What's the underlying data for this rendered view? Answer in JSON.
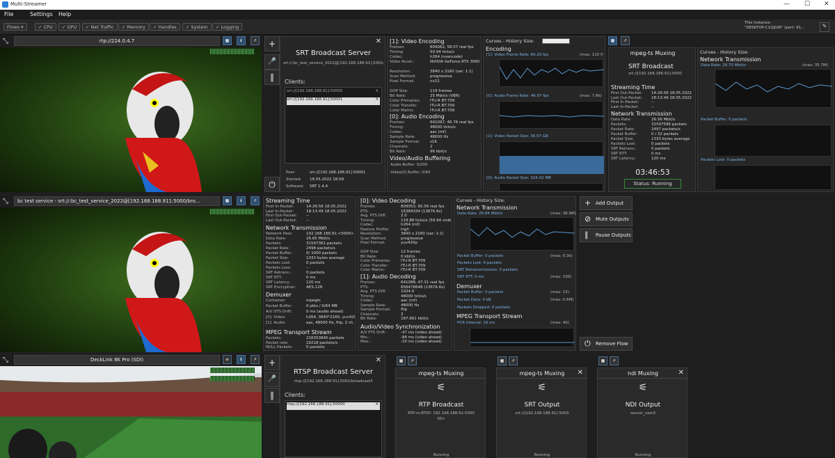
{
  "window": {
    "title": "Multi-Streamer"
  },
  "menu": [
    "File",
    "Settings",
    "Help"
  ],
  "toolbar": {
    "flows": "Flows ▾",
    "toggles": [
      "CPU",
      "GPU",
      "Net Traffic",
      "Memory",
      "Handles",
      "System",
      "Logging"
    ],
    "instance_label": "This Instance:",
    "instance_value": "\"DESKTOP-C1QJGIR\" (port: 91..."
  },
  "flows": [
    {
      "title": "rtp://224.0.4.7"
    },
    {
      "title": "bc test service - srt://:bc_test_service_2022@[192.168.188.911:5000/bro..."
    },
    {
      "title": "DeckLink 8K Pro (SDI)"
    }
  ],
  "srt_server": {
    "title": "SRT Broadcast Server",
    "url": "srt://:bc_test_service_2022@[192.168.188.91]:5000/broadcast3",
    "clients_label": "Clients:",
    "clients": [
      "srt://[192.168.188.91]:50000",
      "srt://[192.168.188.91]:50001"
    ],
    "peer_label": "Peer:",
    "peer": "srt://[192.168.188.91]:50001",
    "started_label": "Started:",
    "started": "18.05.2022 18:09",
    "software_label": "Software:",
    "software": "SRT 1.4.4"
  },
  "video_encoding": {
    "title": "[1]: Video Encoding",
    "rows": [
      [
        "Frames:",
        "809062, 58.07 real fps"
      ],
      [
        "Timing:",
        "59.94 ticks/s"
      ],
      [
        "Codec:",
        "h264 (nvencode)"
      ],
      [
        "Video Accel.:",
        "NVIDIA GeForce RTX 3060"
      ],
      [
        "",
        "[DirectX API]"
      ],
      [
        "Resolution:",
        "3840 x 2160 (sar: 1:1)"
      ],
      [
        "Scan Method:",
        "progressive"
      ],
      [
        "Pixel Format:",
        "nv12"
      ],
      [
        "",
        "(YUV 4:2:0, 8 bit)"
      ],
      [
        "GOP Size:",
        "119 frames"
      ],
      [
        "Bit Rate:",
        "25 Mbit/s (VBR)"
      ],
      [
        "Color Primaries:",
        "ITU-R BT.709"
      ],
      [
        "Color Transfer:",
        "ITU-R BT.709"
      ],
      [
        "Color Matrix:",
        "ITU-R BT.709"
      ]
    ]
  },
  "audio_encoding": {
    "title": "[0]: Audio Encoding",
    "rows": [
      [
        "Frames:",
        "641097, 46.76 real fps"
      ],
      [
        "Timing:",
        "48000 ticks/s"
      ],
      [
        "Codec:",
        "aac (mf)"
      ],
      [
        "Sample Rate:",
        "48000 Hz"
      ],
      [
        "Sample Format:",
        "s16"
      ],
      [
        "Channels:",
        "2"
      ],
      [
        "Bit Rate:",
        "96 kbit/s"
      ]
    ]
  },
  "av_buffering": {
    "title": "Video/Audio Buffering",
    "audio_buffer": "Audio Buffer: 0/200",
    "video_buffer": "Video[0] Buffer: 0/60"
  },
  "curves1": {
    "title": "Curves - History Size:",
    "section": "Encoding",
    "series": [
      "[1]: Video Frame Rate: 60.20 fps",
      "[0]: Audio Frame Rate: 46.07 fps",
      "[1]: Video Packet Size: 36.57 GB",
      "[0]: Audio Packet Size: 324.02 MB"
    ],
    "max": [
      "(max: 110 f)",
      "(max: 7.8k)"
    ],
    "ticks": [
      "30s",
      "24s",
      "18s",
      "12s",
      "6s",
      "1"
    ]
  },
  "mpegts1": {
    "title": "mpeg-ts Muxing",
    "out": "SRT Broadcast",
    "out_url": "srt://[192.168.188.91]:5000",
    "streaming_time": "Streaming Time",
    "st_rows": [
      [
        "First Out-Packet:",
        "14:26:56 18.05.2022"
      ],
      [
        "Last Out-Packet:",
        "18:13:49 18.05.2022"
      ],
      [
        "First In-Packet:",
        "--"
      ],
      [
        "Last In-Packet:",
        "--"
      ]
    ],
    "net": "Network Transmission",
    "net_rows": [
      [
        "Data Rate:",
        "26.56 Mbit/s"
      ],
      [
        "Packets:",
        "31597596 packets"
      ],
      [
        "Packet Rate:",
        "2497 packets/s"
      ],
      [
        "Packet Buffer:",
        "0 / 32 packets"
      ],
      [
        "Packet Size:",
        "1333 bytes average"
      ],
      [
        "Packets Lost:",
        "0 packets"
      ],
      [
        "SRT Retrans.:",
        "0 packets"
      ],
      [
        "SRT RTT:",
        "0 ms"
      ],
      [
        "SRT Latency:",
        "120 ms"
      ]
    ],
    "timer": "03:46:53",
    "status": "Status: Running",
    "curves": "Curves - History Size:",
    "curve_section": "Network Transmission",
    "curve_rate": "Data Rate: 26.70 Mbit/s",
    "curve_max": "(max: 35.7M)",
    "pkt_buffer": "Packet Buffer: 0 packets",
    "pkt_lost": "Packets Lost: 0 packets"
  },
  "streaming2": {
    "title": "Streaming Time",
    "rows": [
      [
        "First In-Packet:",
        "14:26:56 18.05.2022"
      ],
      [
        "Last In-Packet:",
        "18:13:49 18.05.2022"
      ],
      [
        "First Out-Packet:",
        "--"
      ],
      [
        "Last Out-Packet:",
        "--"
      ]
    ],
    "net": "Network Transmission",
    "net_rows": [
      [
        "Network Peer:",
        "192.168.188.91:<5000>"
      ],
      [
        "Data Rate:",
        "26.65 Mbit/s"
      ],
      [
        "Packets:",
        "31597361 packets"
      ],
      [
        "Packet Rate:",
        "2498 packets/s"
      ],
      [
        "Packet Buffer:",
        "0/ 1000 packets"
      ],
      [
        "Packet Size:",
        "1333 bytes average"
      ],
      [
        "Packets Lost:",
        "0 packets"
      ],
      [
        "Packets Loss:",
        "--"
      ],
      [
        "SRT Retrans.:",
        "0 packets"
      ],
      [
        "SRT RTT:",
        "0 ms"
      ],
      [
        "SRT Latency:",
        "120 ms"
      ],
      [
        "SRT Encryption:",
        "AES-128"
      ]
    ],
    "demux": "Demuxer",
    "demux_rows": [
      [
        "Container:",
        "mpegts"
      ],
      [
        "Packet Buffer:",
        "0 pkts / 0/64 MB"
      ],
      [
        "A/V DTS Drift:",
        "0 ms (audio ahead)"
      ],
      [
        "[0]: Video:",
        "h264, 3840*2160, yuv420p"
      ],
      [
        "[1]: Audio:",
        "aac, 48000 Hz, fltp, 2 ch."
      ]
    ],
    "mpeg": "MPEG Transport Stream",
    "mpeg_rows": [
      [
        "Packets:",
        "216353840 packets"
      ],
      [
        "Packet rate:",
        "19218 packets/s"
      ],
      [
        "NULL Packets:",
        "0 packets"
      ]
    ]
  },
  "video_decoding": {
    "title": "[0]: Video Decoding",
    "rows": [
      [
        "Frames:",
        "809053, 60.56 real fps"
      ],
      [
        "PTS:",
        "16384334 (13676.6s)"
      ],
      [
        "Avg. PTS Diff:",
        "2.0"
      ],
      [
        "Timing:",
        "119.88 ticks/s (59.94 visible fr"
      ],
      [
        "Codec:",
        "h264 (mf)"
      ],
      [
        "Feature Profile:",
        "high"
      ],
      [
        "Resolution:",
        "3840 x 2160 (sar: 1:1)"
      ],
      [
        "Scan Method:",
        "progressive"
      ],
      [
        "Pixel Format:",
        "yuv420p"
      ],
      [
        "",
        "(YUV 4:2:0, 8 bit)"
      ],
      [
        "GOP Size:",
        "12 frames"
      ],
      [
        "Bit Rate:",
        "0 kbit/s"
      ],
      [
        "Color Primaries:",
        "ITU-R BT.709"
      ],
      [
        "Color Transfer:",
        "ITU-R BT.709"
      ],
      [
        "Color Matrix:",
        "ITU-R BT.709"
      ]
    ]
  },
  "audio_decoding": {
    "title": "[1]: Audio Decoding",
    "rows": [
      [
        "Frames:",
        "641088, 47.31 real fps"
      ],
      [
        "PTS:",
        "656478648 (13676.6s)"
      ],
      [
        "Avg. PTS Diff:",
        "1024.0"
      ],
      [
        "Timing:",
        "48000 ticks/s"
      ],
      [
        "Codec:",
        "aac (mf)"
      ],
      [
        "Sample Rate:",
        "48000 Hz"
      ],
      [
        "Sample Format:",
        "fltp"
      ],
      [
        "Channels:",
        "2"
      ],
      [
        "Bit Rate:",
        "187.961 kbit/s"
      ]
    ]
  },
  "av_sync": {
    "title": "Audio/Video Synchronization",
    "rows": [
      [
        "A/V PTS Drift:",
        "-47 ms (video ahead)"
      ],
      [
        "Min.:",
        "-84 ms (video ahead)"
      ],
      [
        "Max.:",
        "-20 ms (video ahead)"
      ]
    ]
  },
  "curves2": {
    "title": "Curves - History Size:",
    "net": "Network Transmission",
    "net_rate": "Data Rate: 26.84 Mbit/s",
    "net_max": "(max: 36.9M)",
    "lines": [
      "Packet Buffer: 0 packets",
      "Packets Lost: 0 packets",
      "SRT Retransmissions: 0 packets",
      "SRT RTT: 0 ms"
    ],
    "line_max": [
      "(max: 0.3k)",
      "(max: 100)"
    ],
    "demux": "Demuxer",
    "demux_lines": [
      "Packet Buffer: 0 packets",
      "Packet Data: 0 kB",
      "Packets Dropped: 0 packets"
    ],
    "demux_max": [
      "(max: 15)",
      "(max: 0.6M)"
    ],
    "mpeg": "MPEG Transport Stream",
    "pcr": "PCR Interval: 16 ms",
    "pcr_max": "(max: 40)",
    "ticks": [
      "30s",
      "24s",
      "18s",
      "12s",
      "6s",
      "1s"
    ]
  },
  "actions": {
    "add": "Add Output",
    "mute": "Mute Outputs",
    "pause": "Pause Outputs",
    "remove": "Remove Flow"
  },
  "rtsp_server": {
    "title": "RTSP Broadcast Server",
    "url": "rtsp://[192.168.188.91]:5001/broadcast3",
    "clients_label": "Clients:",
    "clients": [
      "rtsp://[192.168.188.91]:50000"
    ]
  },
  "outputs": [
    {
      "mux": "mpeg-ts Muxing",
      "name": "RTP Broadcast",
      "url": "RTP-in-RTSP: 192.168.188.91:5000",
      "url2": "00>",
      "status": "Running"
    },
    {
      "mux": "mpeg-ts Muxing",
      "name": "SRT Output",
      "url": "srt://[192.168.188.91]:5003",
      "url2": "",
      "status": "Running"
    },
    {
      "mux": "ndi Muxing",
      "name": "NDI Output",
      "url": "soccer_cam3",
      "url2": "",
      "status": "Running"
    }
  ],
  "colors": {
    "accent": "#2a7fd4",
    "meter": "#4ec34e",
    "graph_line": "#5b9bd5",
    "status_green": "#3a8a3a"
  }
}
